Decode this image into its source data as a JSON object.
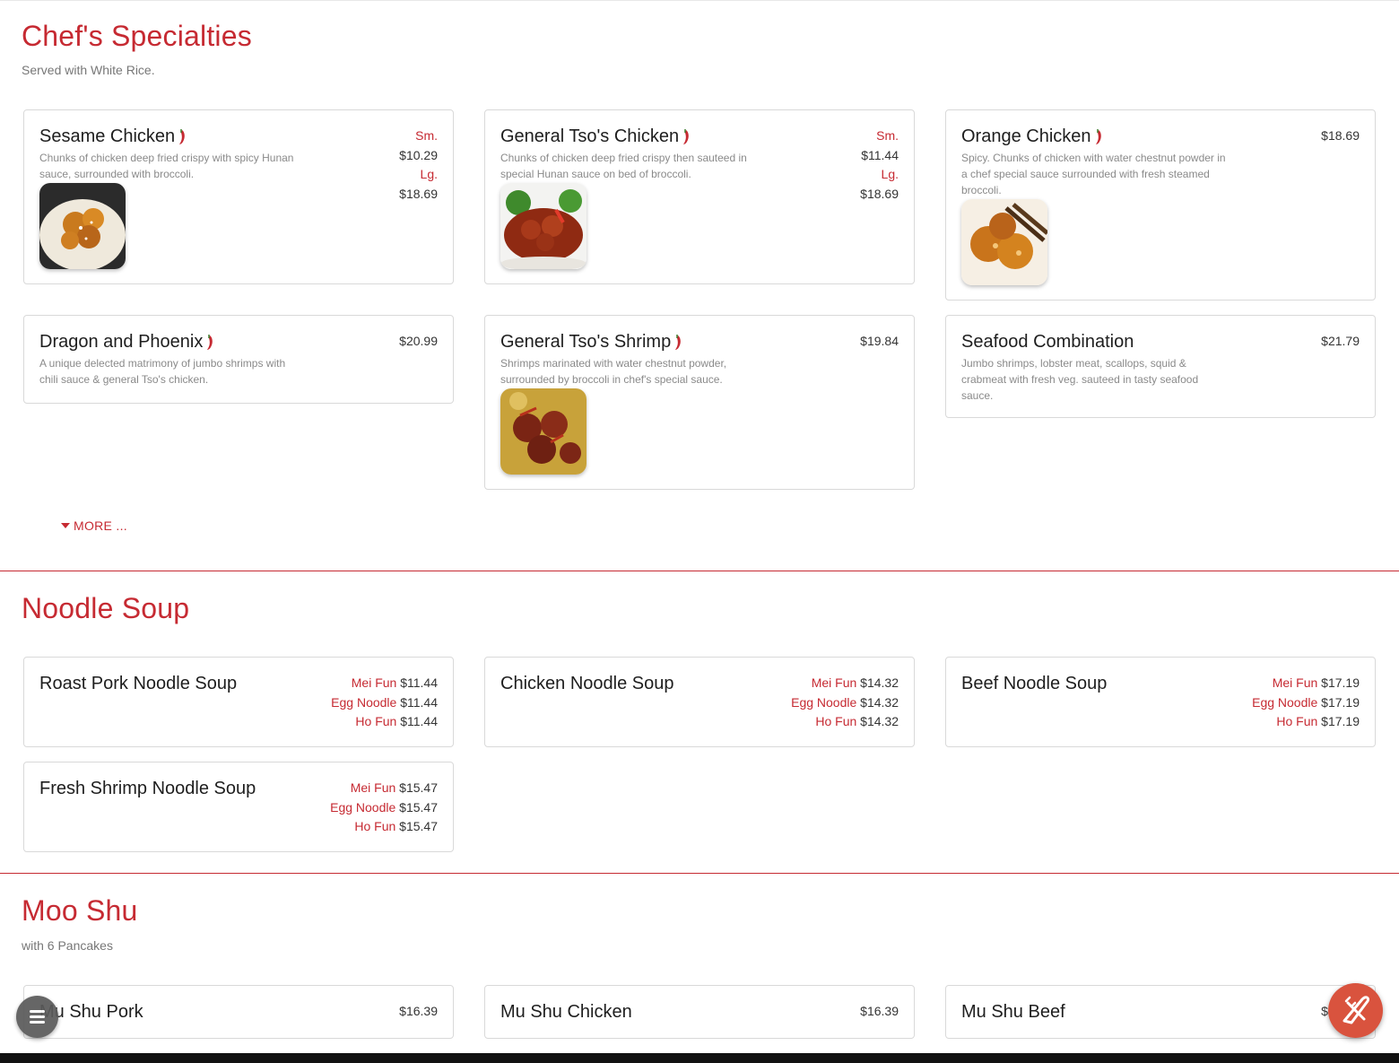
{
  "sections": {
    "chefs": {
      "title": "Chef's Specialties",
      "subtitle": "Served with White Rice.",
      "more_label": "MORE ...",
      "items": [
        {
          "name": "Sesame Chicken",
          "desc": "Chunks of chicken deep fried crispy with spicy Hunan sauce, surrounded with broccoli.",
          "sm_label": "Sm.",
          "sm_price": "$10.29",
          "lg_label": "Lg.",
          "lg_price": "$18.69",
          "spicy": true
        },
        {
          "name": "General Tso's Chicken",
          "desc": "Chunks of chicken deep fried crispy then sauteed in special Hunan sauce on bed of broccoli.",
          "sm_label": "Sm.",
          "sm_price": "$11.44",
          "lg_label": "Lg.",
          "lg_price": "$18.69",
          "spicy": true
        },
        {
          "name": "Orange Chicken",
          "desc": "Spicy. Chunks of chicken with water chestnut powder in a chef special sauce surrounded with fresh steamed broccoli.",
          "price": "$18.69",
          "spicy": true
        },
        {
          "name": "Dragon and Phoenix",
          "desc": "A unique delected matrimony of jumbo shrimps with chili sauce & general Tso's chicken.",
          "price": "$20.99",
          "spicy": true
        },
        {
          "name": "General Tso's Shrimp",
          "desc": "Shrimps marinated with water chestnut powder, surrounded by broccoli in chef's special sauce.",
          "price": "$19.84",
          "spicy": true
        },
        {
          "name": "Seafood Combination",
          "desc": "Jumbo shrimps, lobster meat, scallops, squid & crabmeat with fresh veg. sauteed in tasty seafood sauce.",
          "price": "$21.79",
          "spicy": false
        }
      ]
    },
    "noodle": {
      "title": "Noodle Soup",
      "items": [
        {
          "name": "Roast Pork Noodle Soup",
          "opts": [
            {
              "label": "Mei Fun",
              "price": "$11.44"
            },
            {
              "label": "Egg Noodle",
              "price": "$11.44"
            },
            {
              "label": "Ho Fun",
              "price": "$11.44"
            }
          ]
        },
        {
          "name": "Chicken Noodle Soup",
          "opts": [
            {
              "label": "Mei Fun",
              "price": "$14.32"
            },
            {
              "label": "Egg Noodle",
              "price": "$14.32"
            },
            {
              "label": "Ho Fun",
              "price": "$14.32"
            }
          ]
        },
        {
          "name": "Beef Noodle Soup",
          "opts": [
            {
              "label": "Mei Fun",
              "price": "$17.19"
            },
            {
              "label": "Egg Noodle",
              "price": "$17.19"
            },
            {
              "label": "Ho Fun",
              "price": "$17.19"
            }
          ]
        },
        {
          "name": "Fresh Shrimp Noodle Soup",
          "opts": [
            {
              "label": "Mei Fun",
              "price": "$15.47"
            },
            {
              "label": "Egg Noodle",
              "price": "$15.47"
            },
            {
              "label": "Ho Fun",
              "price": "$15.47"
            }
          ]
        }
      ]
    },
    "mooshu": {
      "title": "Moo Shu",
      "subtitle": "with 6 Pancakes",
      "items": [
        {
          "name": "Mu Shu Pork",
          "price": "$16.39"
        },
        {
          "name": "Mu Shu Chicken",
          "price": "$16.39"
        },
        {
          "name": "Mu Shu Beef",
          "price": "$19.19"
        }
      ]
    }
  },
  "colors": {
    "accent": "#c62a32",
    "fab_order": "#d9533e",
    "fab_menu": "#5a5a5a"
  },
  "icons": {
    "spicy": "chili-pepper-icon",
    "menu_fab": "hamburger-menu-icon",
    "order_fab": "fork-knife-icon",
    "more": "caret-down-icon"
  }
}
